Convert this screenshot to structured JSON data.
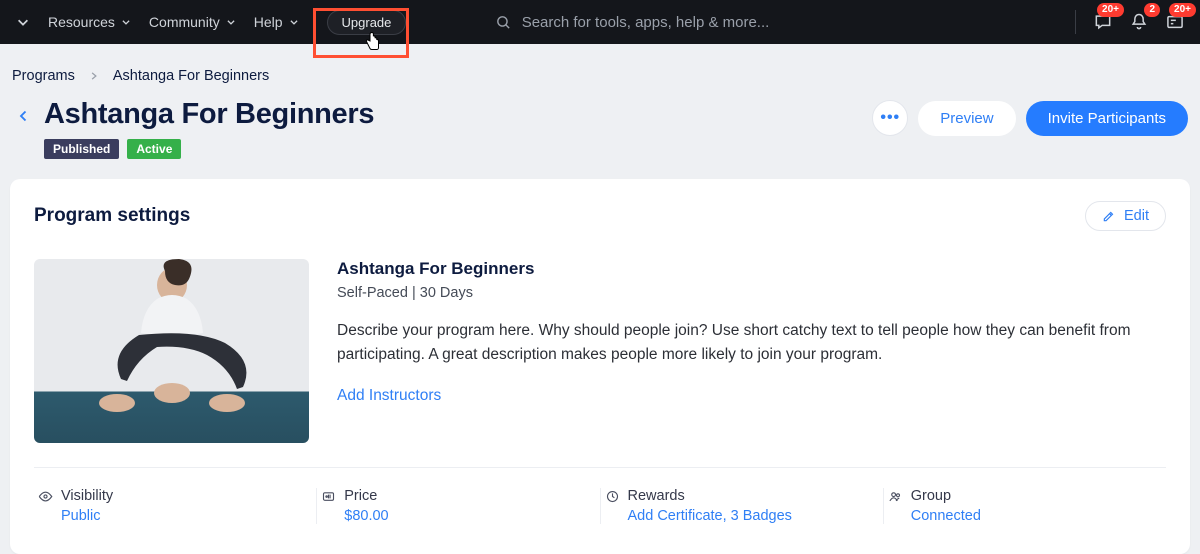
{
  "topbar": {
    "nav": [
      {
        "label": "Resources"
      },
      {
        "label": "Community"
      },
      {
        "label": "Help"
      }
    ],
    "upgrade": "Upgrade",
    "search_placeholder": "Search for tools, apps, help & more...",
    "badge_chat": "20+",
    "badge_bell": "2",
    "badge_card": "20+"
  },
  "breadcrumb": {
    "root": "Programs",
    "current": "Ashtanga For Beginners"
  },
  "title": "Ashtanga For Beginners",
  "status": {
    "published": "Published",
    "active": "Active"
  },
  "actions": {
    "preview": "Preview",
    "invite": "Invite Participants"
  },
  "card": {
    "title": "Program settings",
    "edit": "Edit",
    "program": {
      "name": "Ashtanga For Beginners",
      "meta": "Self-Paced | 30 Days",
      "desc": "Describe your program here. Why should people join? Use short catchy text to tell people how they can benefit from participating. A great description makes people more likely to join your program.",
      "add_instructors": "Add Instructors"
    },
    "stats": {
      "visibility": {
        "label": "Visibility",
        "value": "Public"
      },
      "price": {
        "label": "Price",
        "value": "$80.00"
      },
      "rewards": {
        "label": "Rewards",
        "value": "Add Certificate, 3 Badges"
      },
      "group": {
        "label": "Group",
        "value": "Connected"
      }
    }
  }
}
